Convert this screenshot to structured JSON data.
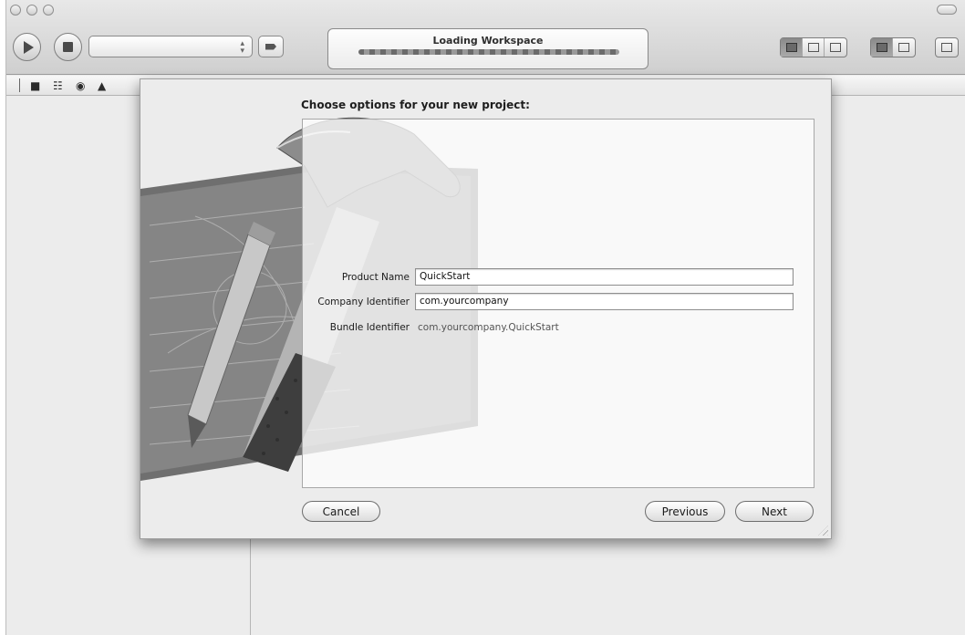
{
  "toolbar": {
    "activity_title": "Loading Workspace",
    "scheme_value": "",
    "progress": 1.0
  },
  "navigator": {
    "icons": [
      "folder-icon",
      "hierarchy-icon",
      "search-icon",
      "warning-icon"
    ]
  },
  "sheet": {
    "title": "Choose options for your new project:",
    "fields": [
      {
        "label": "Product Name",
        "value": "QuickStart"
      },
      {
        "label": "Company Identifier",
        "value": "com.yourcompany"
      }
    ],
    "bundle": {
      "label": "Bundle Identifier",
      "value": "com.yourcompany.QuickStart"
    },
    "buttons": {
      "cancel": "Cancel",
      "previous": "Previous",
      "next": "Next"
    }
  }
}
